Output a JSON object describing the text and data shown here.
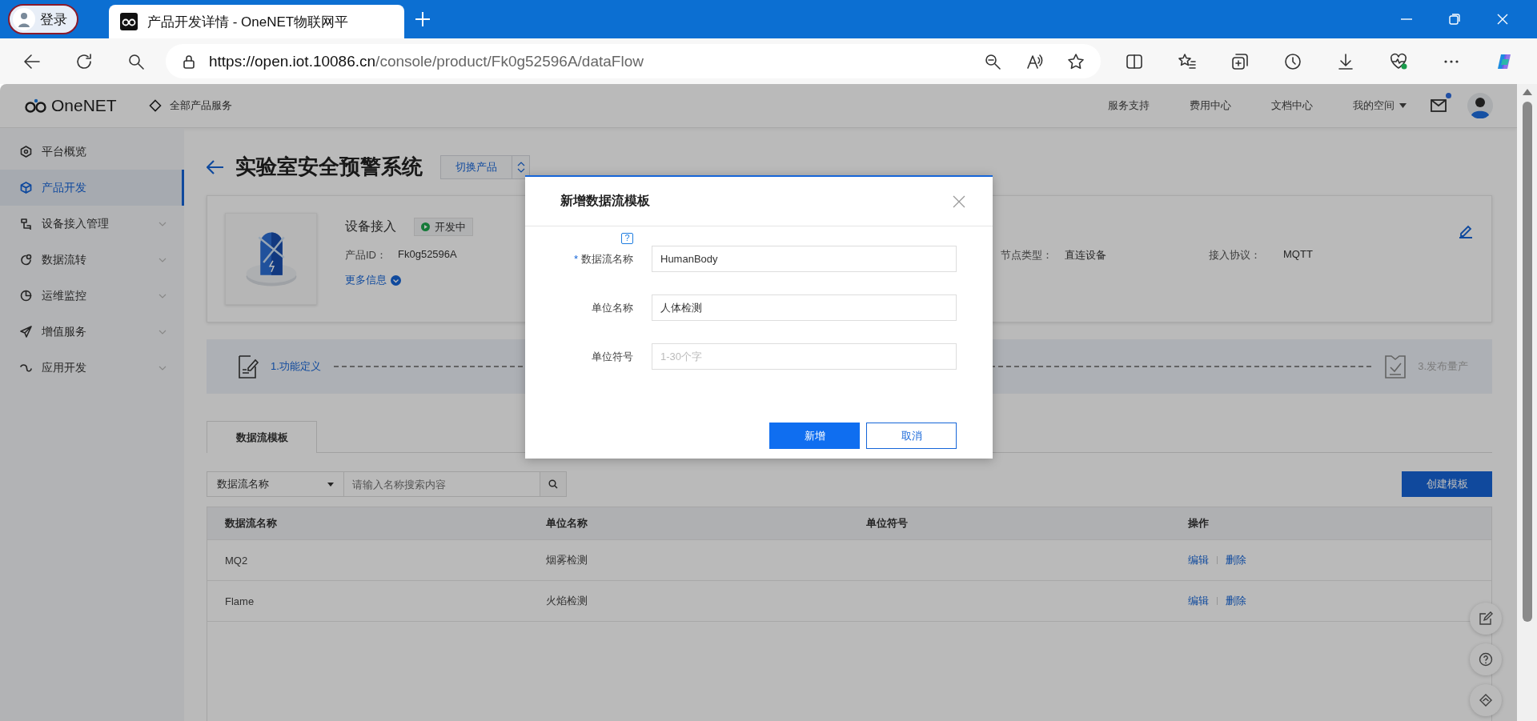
{
  "browser": {
    "login": "登录",
    "tab_title": "产品开发详情 - OneNET物联网平",
    "url_host": "https://open.iot.10086.cn",
    "url_path": "/console/product/Fk0g52596A/dataFlow"
  },
  "header": {
    "logo": "OneNET",
    "all_services": "全部产品服务",
    "links": [
      "服务支持",
      "费用中心",
      "文档中心"
    ],
    "my_space": "我的空间",
    "mail_unread": true
  },
  "sidebar": {
    "items": [
      {
        "label": "平台概览",
        "selected": false,
        "expandable": false
      },
      {
        "label": "产品开发",
        "selected": true,
        "expandable": false
      },
      {
        "label": "设备接入管理",
        "selected": false,
        "expandable": true
      },
      {
        "label": "数据流转",
        "selected": false,
        "expandable": true
      },
      {
        "label": "运维监控",
        "selected": false,
        "expandable": true
      },
      {
        "label": "增值服务",
        "selected": false,
        "expandable": true
      },
      {
        "label": "应用开发",
        "selected": false,
        "expandable": true
      }
    ]
  },
  "product": {
    "title": "实验室安全预警系统",
    "switch": "切换产品",
    "name": "设备接入",
    "status": "开发中",
    "id_label": "产品ID：",
    "id_value": "Fk0g52596A",
    "more": "更多信息",
    "fields": [
      {
        "label": "节点类型：",
        "value": "直连设备"
      },
      {
        "label": "接入协议：",
        "value": "MQTT"
      }
    ]
  },
  "steps": [
    {
      "label": "1.功能定义",
      "selected": true
    },
    {
      "label": "3.发布量产",
      "selected": false
    }
  ],
  "tabs": [
    {
      "label": "数据流模板",
      "selected": true
    }
  ],
  "search": {
    "filter": "数据流名称",
    "placeholder": "请输入名称搜索内容"
  },
  "create_button": "创建模板",
  "table": {
    "columns": [
      "数据流名称",
      "单位名称",
      "单位符号",
      "操作"
    ],
    "rows": [
      {
        "name": "MQ2",
        "unit_name": "烟雾检测",
        "actions": [
          "编辑",
          "删除"
        ]
      },
      {
        "name": "Flame",
        "unit_name": "火焰检测",
        "actions": [
          "编辑",
          "删除"
        ]
      }
    ]
  },
  "dialog": {
    "title": "新增数据流模板",
    "help_glyph": "?",
    "required_mark": "*",
    "fields": [
      {
        "label": "数据流名称",
        "required": true,
        "help": true,
        "value": "HumanBody"
      },
      {
        "label": "单位名称",
        "required": false,
        "help": false,
        "value": "人体检测"
      },
      {
        "label": "单位符号",
        "required": false,
        "help": false,
        "placeholder": "1-30个字"
      }
    ],
    "buttons": [
      {
        "label": "新增",
        "kind": "primary"
      },
      {
        "label": "取消",
        "kind": "secondary"
      }
    ]
  }
}
